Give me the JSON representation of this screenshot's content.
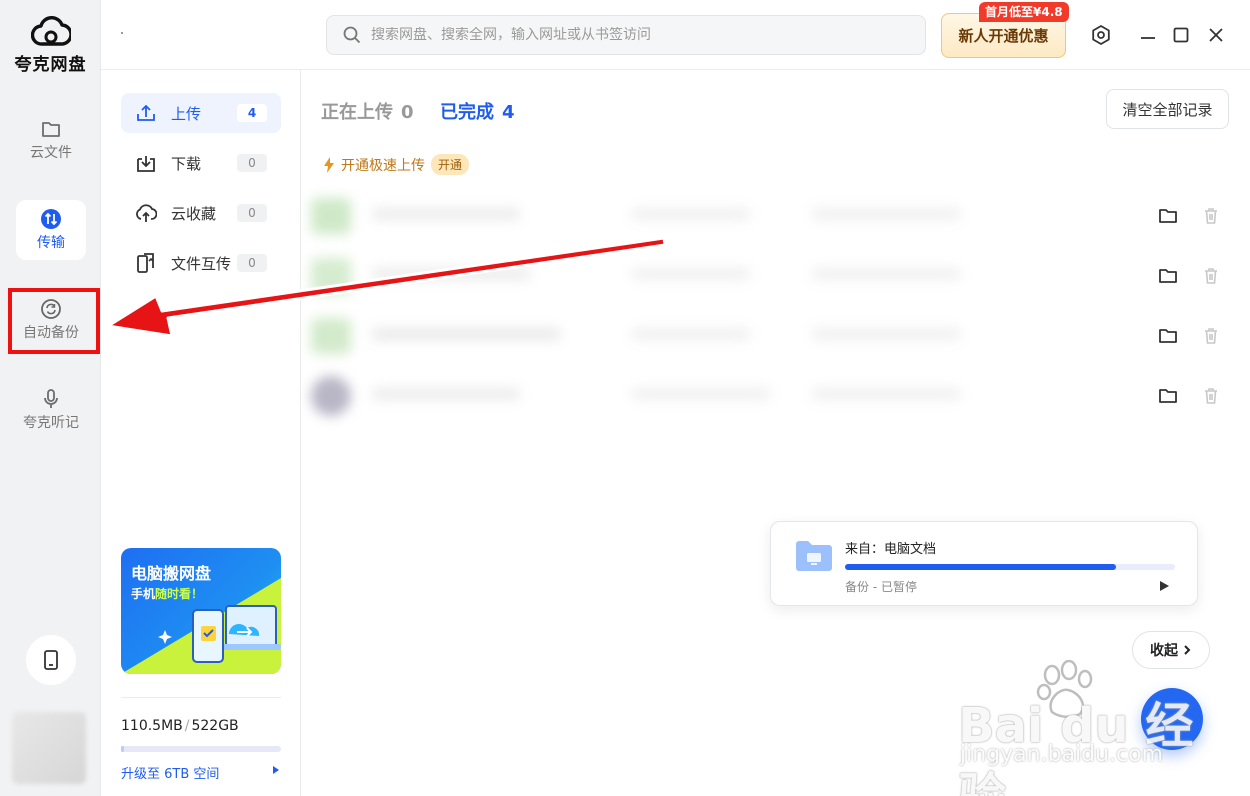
{
  "app": {
    "name": "夸克网盘"
  },
  "rail": {
    "items": [
      {
        "label": "云文件",
        "icon": "folder-icon"
      },
      {
        "label": "传输",
        "icon": "transfer-icon",
        "active": true
      },
      {
        "label": "自动备份",
        "icon": "sync-icon",
        "highlighted": true
      },
      {
        "label": "夸克听记",
        "icon": "microphone-icon"
      }
    ],
    "device_icon": "phone-icon"
  },
  "topbar": {
    "search_placeholder": "搜索网盘、搜索全网，输入网址或从书签访问",
    "promo_label": "新人开通优惠",
    "promo_badge": "首月低至¥4.8",
    "window_controls": [
      "settings-icon",
      "minimize-icon",
      "maximize-icon",
      "close-icon"
    ]
  },
  "transfer_nav": [
    {
      "label": "上传",
      "count": "4",
      "icon": "upload-icon",
      "active": true
    },
    {
      "label": "下载",
      "count": "0",
      "icon": "download-icon"
    },
    {
      "label": "云收藏",
      "count": "0",
      "icon": "cloud-save-icon"
    },
    {
      "label": "文件互传",
      "count": "0",
      "icon": "file-transfer-icon"
    }
  ],
  "banner": {
    "title": "电脑搬网盘",
    "subtitle_a": "手机",
    "subtitle_b": "随时看！"
  },
  "quota": {
    "used": "110.5MB",
    "sep": "/",
    "total": "522GB",
    "fraction": 0.0002,
    "upgrade_label": "升级至 6TB 空间"
  },
  "main": {
    "tabs": [
      {
        "label": "正在上传",
        "count": "0",
        "active": false
      },
      {
        "label": "已完成",
        "count": "4",
        "active": true
      }
    ],
    "clear_label": "清空全部记录",
    "speed_label": "开通极速上传",
    "speed_badge": "开通",
    "rows": [
      {
        "actions": [
          "folder-icon",
          "trash-icon"
        ]
      },
      {
        "actions": [
          "folder-icon",
          "trash-icon"
        ]
      },
      {
        "actions": [
          "folder-icon",
          "trash-icon"
        ]
      },
      {
        "actions": [
          "folder-icon",
          "trash-icon"
        ]
      }
    ]
  },
  "backup_card": {
    "source_label": "来自：电脑文档",
    "status": "备份 - 已暂停",
    "progress": 0.82
  },
  "collapse_label": "收起",
  "watermark": {
    "brand": "Bai du 经验",
    "url": "jingyan.baidu.com"
  },
  "colors": {
    "accent": "#1f5cf0",
    "promo_red": "#f23a2a",
    "annotation_red": "#e11111"
  }
}
